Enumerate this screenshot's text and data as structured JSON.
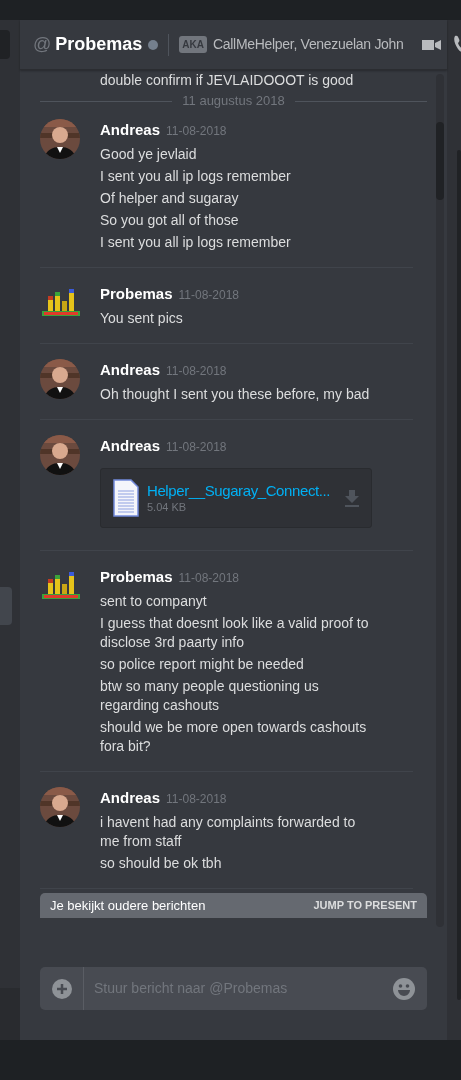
{
  "header": {
    "at": "@",
    "name": "Probemas",
    "status_dot": {
      "color": "#747f8d"
    },
    "aka_label": "AKA",
    "aka_names": "CallMeHelper, Venezuelan John"
  },
  "partial_message": "double confirm if JEVLAIDOOOT is good",
  "date_divider": "11 augustus 2018",
  "messages": [
    {
      "author": "Andreas",
      "timestamp": "11-08-2018",
      "kind": "person",
      "lines": [
        "Good ye jevlaid",
        "I sent you all ip logs remember",
        "Of helper and sugaray",
        "So you got all of those",
        "I sent you all ip logs remember"
      ]
    },
    {
      "author": "Probemas",
      "timestamp": "11-08-2018",
      "kind": "logo",
      "lines": [
        "You sent pics"
      ]
    },
    {
      "author": "Andreas",
      "timestamp": "11-08-2018",
      "kind": "person",
      "lines": [
        "Oh thought I sent you these before, my bad"
      ]
    },
    {
      "author": "Andreas",
      "timestamp": "11-08-2018",
      "kind": "person",
      "attachment": {
        "name": "Helper__Sugaray_Connect...",
        "size": "5.04 KB"
      }
    },
    {
      "author": "Probemas",
      "timestamp": "11-08-2018",
      "kind": "logo",
      "lines": [
        "sent to companyt",
        "I guess that doesnt look like a valid proof to disclose 3rd paarty info",
        "so police report might be needed",
        "btw so many people questioning us regarding cashouts",
        "should we be more open towards cashouts fora bit?"
      ]
    },
    {
      "author": "Andreas",
      "timestamp": "11-08-2018",
      "kind": "person",
      "lines": [
        "i havent had any complaints forwarded to me from staff",
        "so should be ok tbh"
      ]
    }
  ],
  "banner": {
    "text": "Je bekijkt oudere berichten",
    "action": "JUMP TO PRESENT"
  },
  "composer": {
    "placeholder": "Stuur bericht naar @Probemas"
  }
}
